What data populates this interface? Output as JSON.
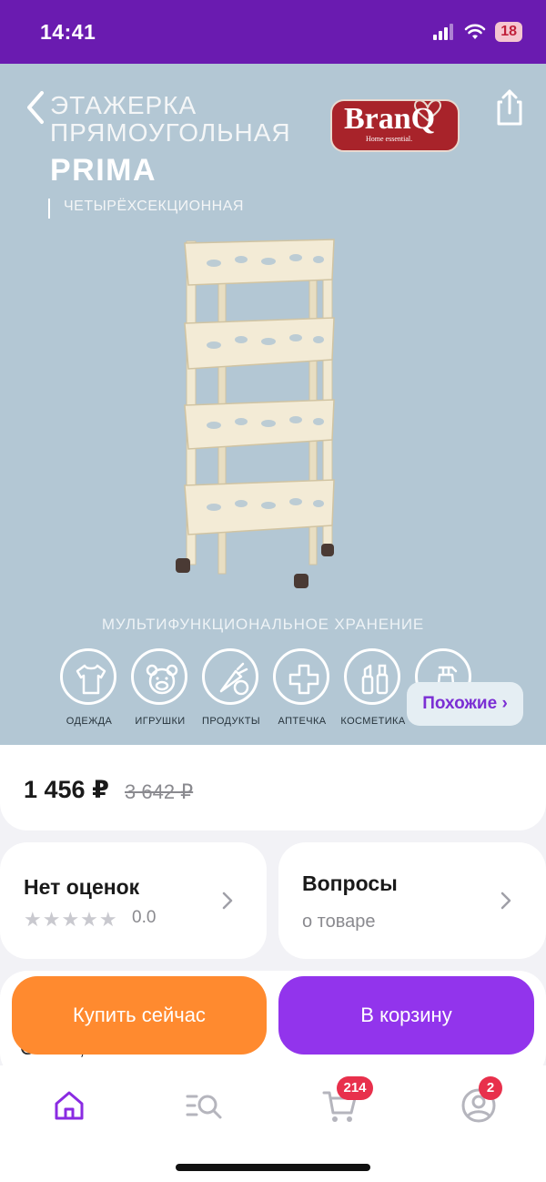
{
  "status_bar": {
    "time": "14:41",
    "battery": "18"
  },
  "product_image": {
    "promo": {
      "line1": "ЭТАЖЕРКА",
      "line2": "ПРЯМОУГОЛЬНАЯ",
      "line3": "PRIMA",
      "line4": "ЧЕТЫРЁХСЕКЦИОННАЯ"
    },
    "brand": {
      "name": "BranQ",
      "tagline": "Home essential."
    },
    "storage_text": "МУЛЬТИФУНКЦИОНАЛЬНОЕ ХРАНЕНИЕ",
    "categories": [
      {
        "label": "ОДЕЖДА",
        "icon": "tshirt-icon"
      },
      {
        "label": "ИГРУШКИ",
        "icon": "teddy-bear-icon"
      },
      {
        "label": "ПРОДУКТЫ",
        "icon": "vegetables-icon"
      },
      {
        "label": "АПТЕЧКА",
        "icon": "medical-cross-icon"
      },
      {
        "label": "КОСМЕТИКА",
        "icon": "cosmetics-icon"
      },
      {
        "label": "",
        "icon": "spray-bottle-icon"
      }
    ],
    "similar_label": "Похожие ›"
  },
  "price": {
    "current": "1 456 ₽",
    "old": "3 642 ₽"
  },
  "rating_card": {
    "title": "Нет оценок",
    "stars": "★★★★★",
    "value": "0.0"
  },
  "questions_card": {
    "title": "Вопросы",
    "subtitle": "о товаре"
  },
  "description_peek": "О                      ван     ,",
  "actions": {
    "buy_now": "Купить сейчас",
    "add_to_cart": "В корзину"
  },
  "bottom_nav": {
    "items": [
      {
        "name": "home",
        "icon": "home-icon",
        "active": true
      },
      {
        "name": "catalog",
        "icon": "catalog-search-icon"
      },
      {
        "name": "cart",
        "icon": "cart-icon",
        "badge": "214"
      },
      {
        "name": "profile",
        "icon": "profile-icon",
        "badge": "2"
      }
    ]
  },
  "colors": {
    "status_bar": "#6a1bb0",
    "image_bg": "#b3c7d4",
    "accent_purple": "#9234ec",
    "accent_orange": "#ff8a2f",
    "badge_red": "#e8304c"
  }
}
